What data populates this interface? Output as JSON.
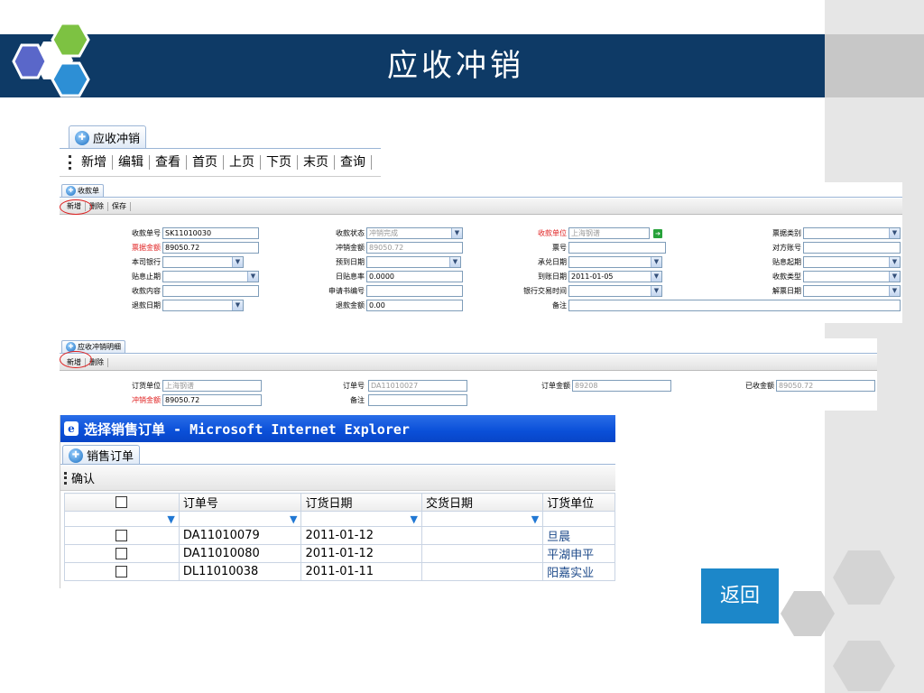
{
  "slide": {
    "title": "应收冲销",
    "back_label": "返回",
    "colors": {
      "title_bar": "#0e3a66",
      "accent": "#1c87c9"
    }
  },
  "main_toolbar": {
    "tab_label": "应收冲销",
    "buttons": [
      "新增",
      "编辑",
      "查看",
      "首页",
      "上页",
      "下页",
      "末页",
      "查询"
    ]
  },
  "receipt": {
    "tab_label": "收款单",
    "toolbar": [
      "新增",
      "删除",
      "保存"
    ],
    "fields": {
      "receipt_no": {
        "label": "收款单号",
        "value": "SK11010030"
      },
      "status": {
        "label": "收款状态",
        "value": "冲销完成"
      },
      "payer": {
        "label": "收款单位",
        "value": "上海钢谱"
      },
      "bill_type": {
        "label": "票据类别",
        "value": ""
      },
      "bill_amount": {
        "label": "票据金额",
        "value": "89050.72"
      },
      "writeoff_amount": {
        "label": "冲销金额",
        "value": "89050.72"
      },
      "bill_no": {
        "label": "票号",
        "value": ""
      },
      "counter_account": {
        "label": "对方账号",
        "value": ""
      },
      "company_bank": {
        "label": "本司银行",
        "value": ""
      },
      "expected_date": {
        "label": "预到日期",
        "value": ""
      },
      "accept_date": {
        "label": "承兑日期",
        "value": ""
      },
      "discount_start": {
        "label": "贴息起期",
        "value": ""
      },
      "discount_end": {
        "label": "贴息止期",
        "value": ""
      },
      "discount_rate": {
        "label": "日贴息率",
        "value": "0.0000"
      },
      "arrival_date": {
        "label": "到账日期",
        "value": "2011-01-05"
      },
      "receipt_type": {
        "label": "收款类型",
        "value": ""
      },
      "content": {
        "label": "收款内容",
        "value": ""
      },
      "application_no": {
        "label": "申请书编号",
        "value": ""
      },
      "bank_txn_time": {
        "label": "银行交易时间",
        "value": ""
      },
      "unfreeze_date": {
        "label": "解票日期",
        "value": ""
      },
      "refund_date": {
        "label": "退款日期",
        "value": ""
      },
      "refund_amount": {
        "label": "退款金额",
        "value": "0.00"
      },
      "remark": {
        "label": "备注",
        "value": ""
      }
    }
  },
  "detail": {
    "tab_label": "应收冲销明细",
    "toolbar": [
      "新增",
      "删除"
    ],
    "fields": {
      "order_party": {
        "label": "订货单位",
        "value": "上海钢谱"
      },
      "order_no": {
        "label": "订单号",
        "value": "DA11010027"
      },
      "order_amount": {
        "label": "订单金额",
        "value": "89208"
      },
      "received_amount": {
        "label": "已收金额",
        "value": "89050.72"
      },
      "writeoff_amount": {
        "label": "冲销金额",
        "value": "89050.72"
      },
      "remark": {
        "label": "备注",
        "value": ""
      }
    }
  },
  "dialog": {
    "title": "选择销售订单 - Microsoft Internet Explorer",
    "tab_label": "销售订单",
    "confirm_label": "确认",
    "columns": [
      "",
      "订单号",
      "订货日期",
      "交货日期",
      "订货单位"
    ],
    "rows": [
      {
        "order_no": "DA11010079",
        "order_date": "2011-01-12",
        "delivery_date": "",
        "party": "旦晨"
      },
      {
        "order_no": "DA11010080",
        "order_date": "2011-01-12",
        "delivery_date": "",
        "party": "平湖申平"
      },
      {
        "order_no": "DL11010038",
        "order_date": "2011-01-11",
        "delivery_date": "",
        "party": "阳嘉实业"
      }
    ]
  }
}
